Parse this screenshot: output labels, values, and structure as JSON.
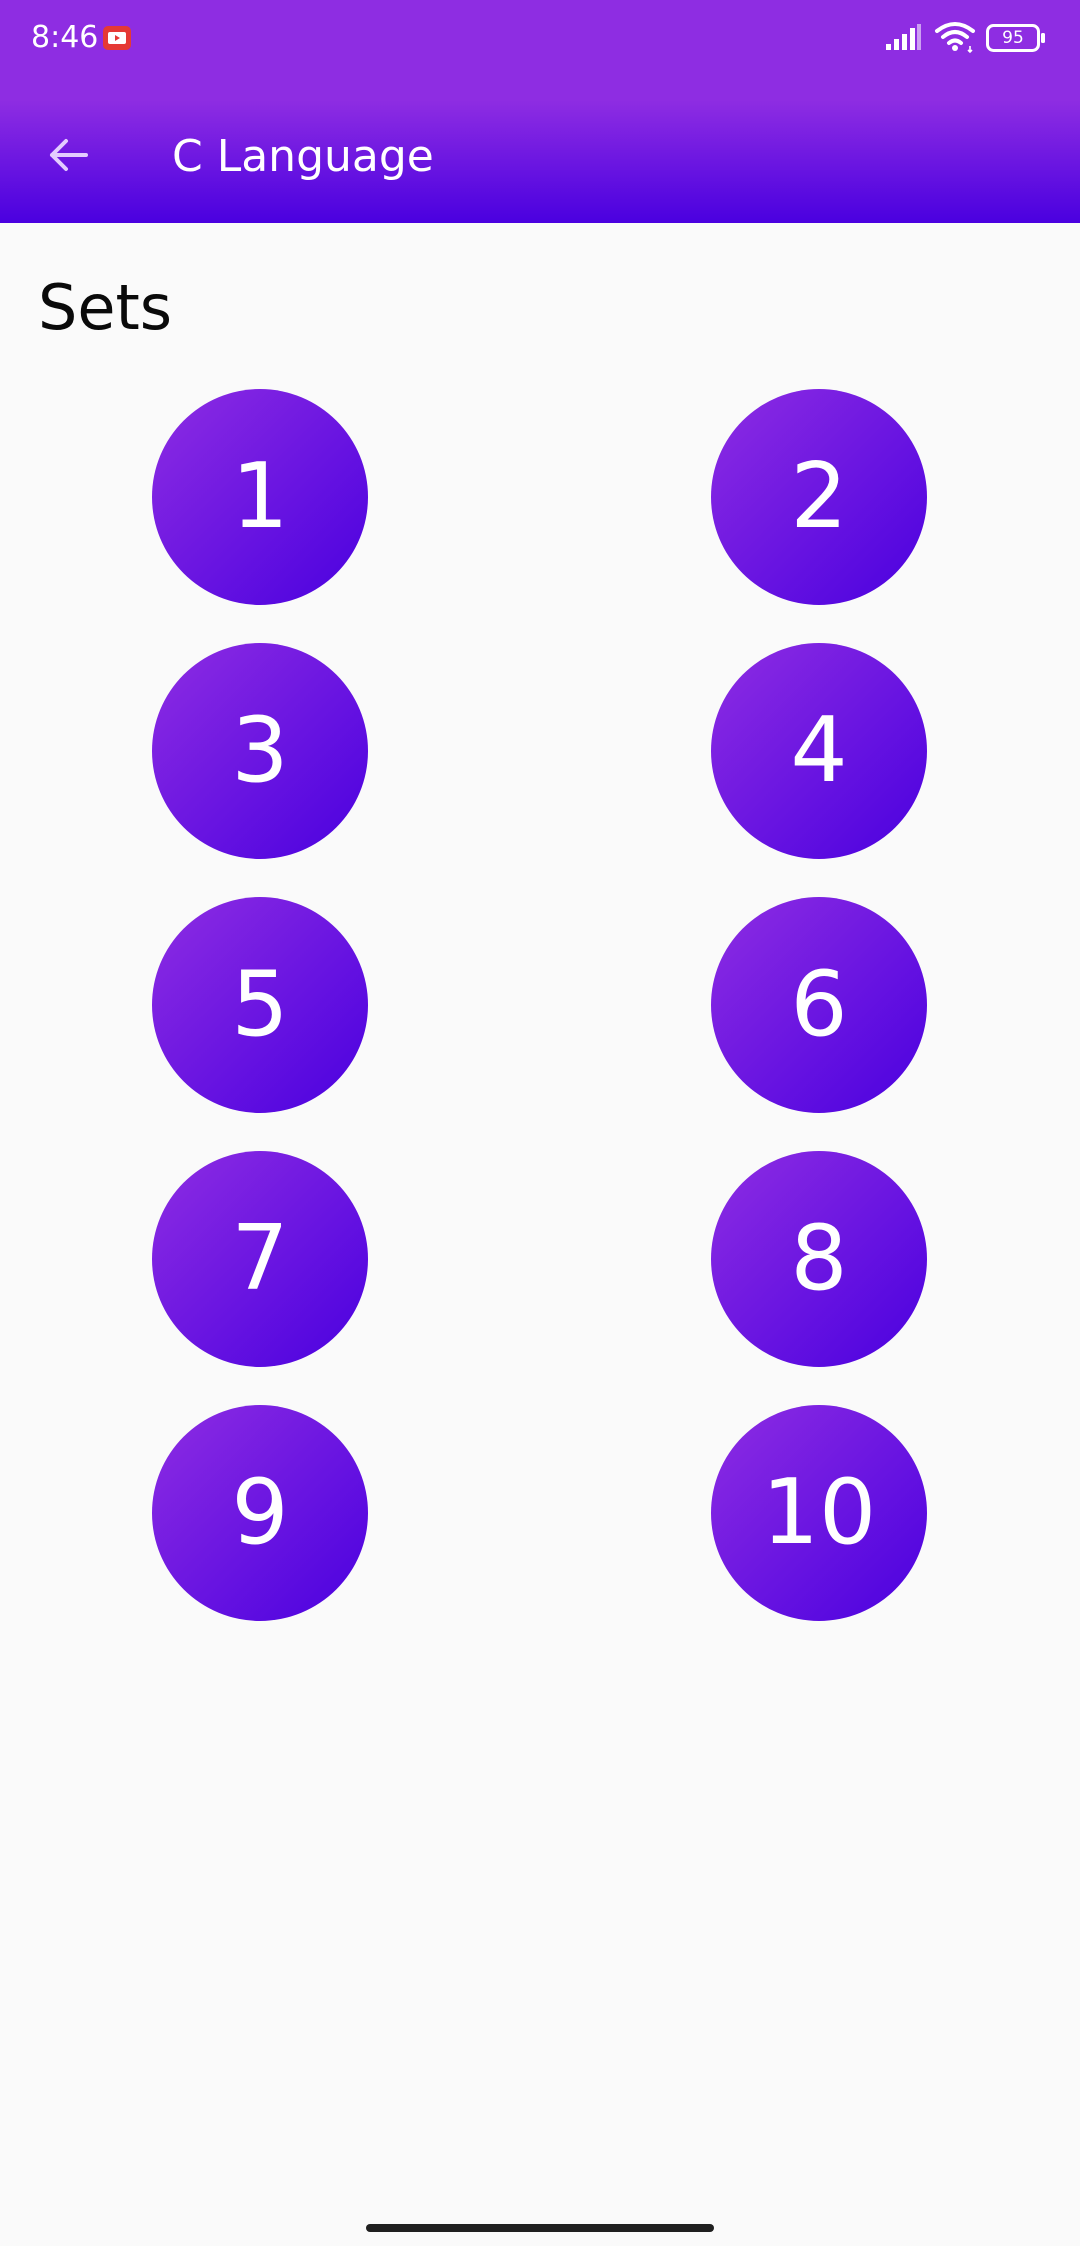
{
  "status_bar": {
    "time": "8:46",
    "battery": "95",
    "icons": [
      "youtube-icon",
      "signal-icon",
      "wifi-icon",
      "battery-icon"
    ]
  },
  "toolbar": {
    "title": "C Language",
    "back_icon": "arrow-back-icon"
  },
  "section": {
    "title": "Sets"
  },
  "sets": [
    {
      "label": "1"
    },
    {
      "label": "2"
    },
    {
      "label": "3"
    },
    {
      "label": "4"
    },
    {
      "label": "5"
    },
    {
      "label": "6"
    },
    {
      "label": "7"
    },
    {
      "label": "8"
    },
    {
      "label": "9"
    },
    {
      "label": "10"
    }
  ],
  "colors": {
    "gradient_start": "#8e2de2",
    "gradient_end": "#4a00e0",
    "background": "#fafafa"
  }
}
